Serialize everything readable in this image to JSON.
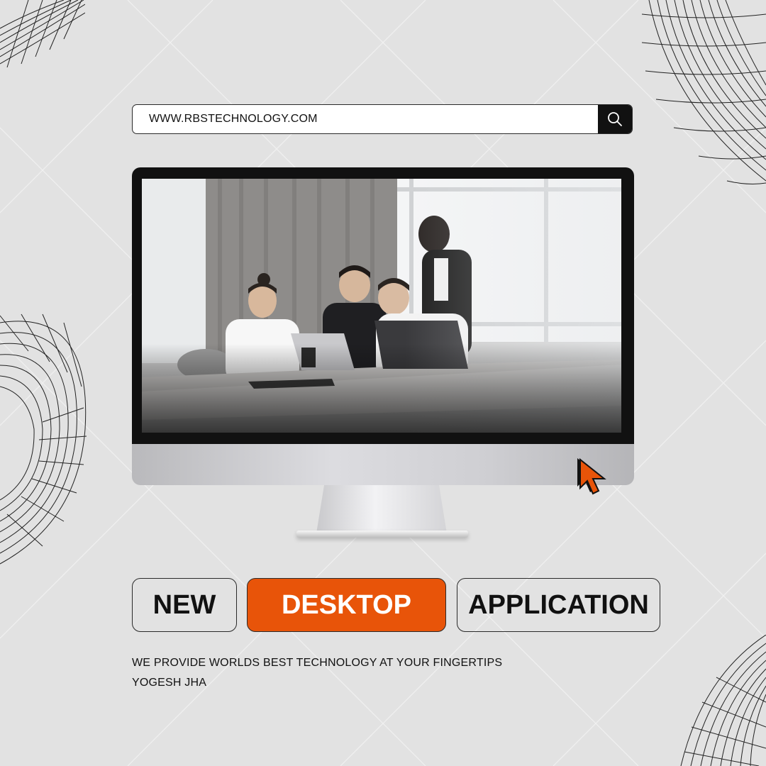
{
  "search": {
    "url_text": "WWW.RBSTECHNOLOGY.COM",
    "icon": "search-icon"
  },
  "monitor": {
    "photo_description_icon": "team-meeting-photo"
  },
  "cursor": {
    "icon": "arrow-cursor-icon",
    "color": "#e85409"
  },
  "headline": {
    "word1": "NEW",
    "word2": "DESKTOP",
    "word3": "APPLICATION",
    "accent_color": "#e85409"
  },
  "tagline": "WE PROVIDE WORLDS BEST TECHNOLOGY AT YOUR FINGERTIPS",
  "author": "YOGESH JHA",
  "colors": {
    "background": "#e2e2e2",
    "dark": "#111111",
    "accent": "#e85409"
  }
}
